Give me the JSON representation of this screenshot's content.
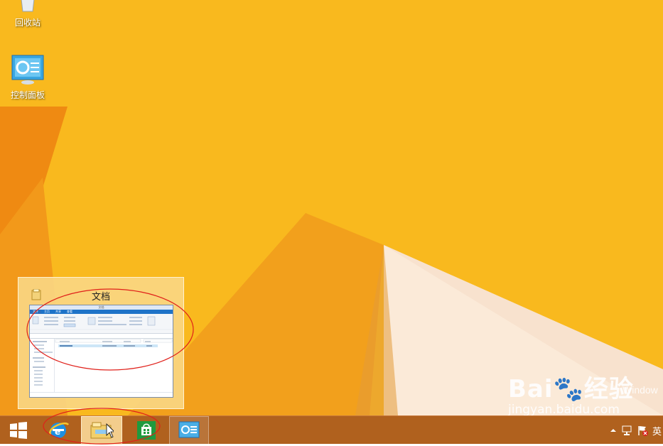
{
  "desktop": {
    "background_color": "#f8b81c",
    "icons": [
      {
        "label": "回收站",
        "icon": "recycle-bin-icon"
      },
      {
        "label": "控制面板",
        "icon": "control-panel-icon"
      }
    ]
  },
  "preview": {
    "title": "文档",
    "thumbnail": {
      "window_title": "文档",
      "tabs": [
        "文件",
        "主页",
        "共享",
        "查看"
      ]
    }
  },
  "taskbar": {
    "items": [
      {
        "name": "start",
        "icon": "windows-start-icon"
      },
      {
        "name": "internet-explorer",
        "icon": "ie-icon"
      },
      {
        "name": "file-explorer",
        "icon": "folder-icon",
        "active": true
      },
      {
        "name": "store",
        "icon": "store-icon"
      },
      {
        "name": "control-panel",
        "icon": "control-panel-icon"
      }
    ],
    "tray": {
      "ime": "英"
    }
  },
  "watermark": {
    "brand": "Bai",
    "brand_cn": "经验",
    "url": "jingyan.baidu.com"
  },
  "windows_text": "Window",
  "annotation_color": "#e0201a"
}
